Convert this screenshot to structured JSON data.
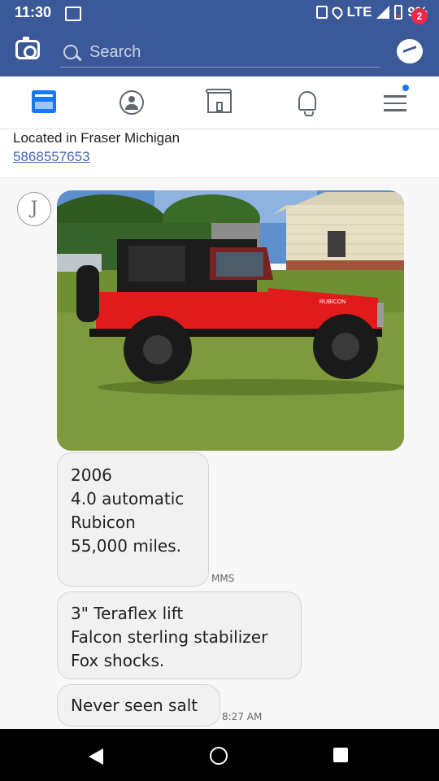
{
  "status_bar": {
    "time": "11:30",
    "network": "LTE",
    "battery": "9%"
  },
  "header": {
    "search_placeholder": "Search",
    "messenger_badge": "2"
  },
  "tabs": [
    "news-feed",
    "groups",
    "marketplace",
    "notifications",
    "menu"
  ],
  "post": {
    "location": "Located in Fraser Michigan",
    "phone": "5868557653"
  },
  "conversation": {
    "avatar_letter": "J",
    "messages": [
      {
        "lines": [
          "2006",
          "4.0 automatic",
          "Rubicon",
          "55,000 miles."
        ]
      },
      {
        "lines": [
          "3\" Teraflex lift",
          "Falcon sterling stabilizer",
          "Fox shocks."
        ]
      },
      {
        "lines": [
          "Never seen salt"
        ]
      }
    ],
    "mms_label": "MMS",
    "timestamp": "8:27 AM",
    "photo_hood_text": "RUBICON"
  },
  "colors": {
    "facebook_blue": "#3b5998",
    "jeep_red": "#e11b1b",
    "badge_red": "#f02849"
  }
}
